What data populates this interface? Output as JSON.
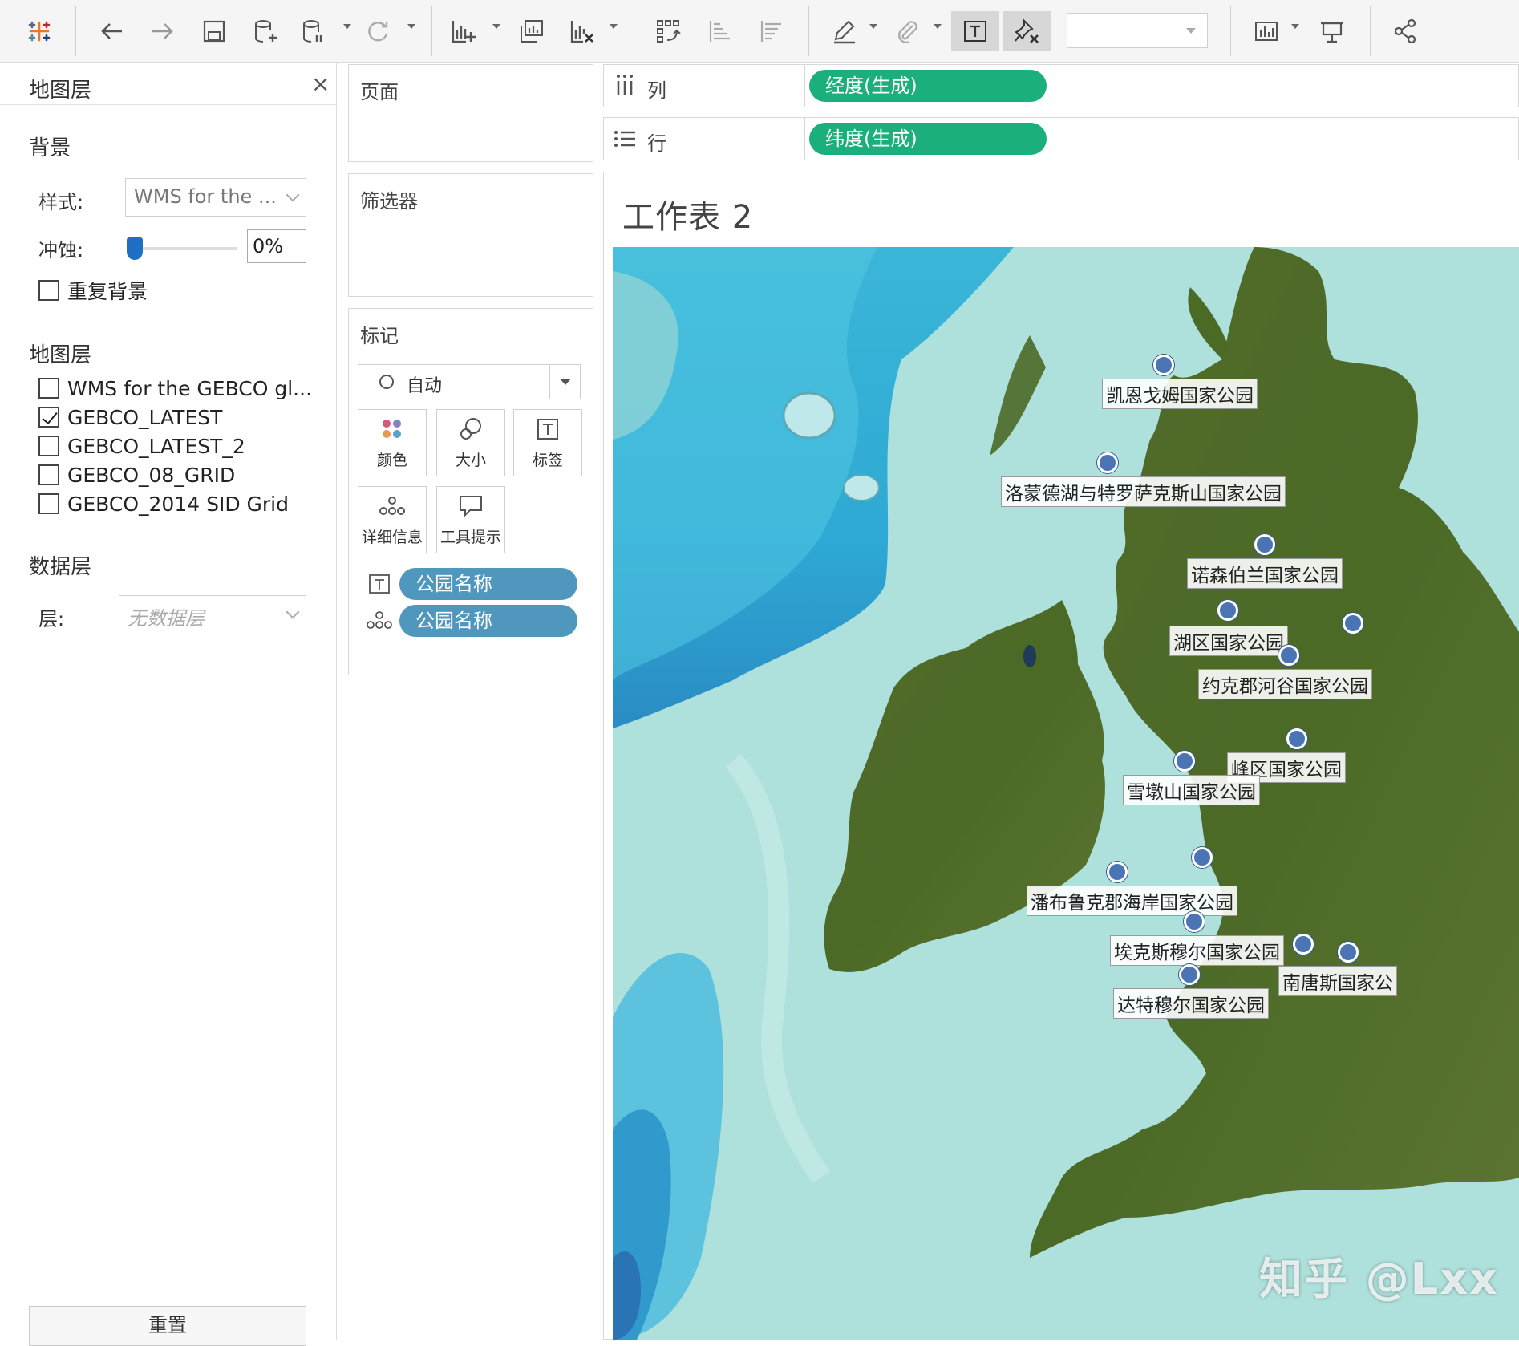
{
  "left_panel": {
    "title": "地图层",
    "background_section": "背景",
    "style_label": "样式:",
    "style_value": "WMS for the ...",
    "washout_label": "冲蚀:",
    "washout_value": "0%",
    "washout_fraction": 0,
    "repeat_background_label": "重复背景",
    "repeat_background_checked": false,
    "map_layers_section": "地图层",
    "layers": [
      {
        "label": "WMS for the GEBCO gl...",
        "checked": false
      },
      {
        "label": "GEBCO_LATEST",
        "checked": true
      },
      {
        "label": "GEBCO_LATEST_2",
        "checked": false
      },
      {
        "label": "GEBCO_08_GRID",
        "checked": false
      },
      {
        "label": "GEBCO_2014 SID Grid",
        "checked": false
      }
    ],
    "data_layer_section": "数据层",
    "layer_label": "层:",
    "layer_placeholder": "无数据层",
    "reset_label": "重置"
  },
  "cards": {
    "pages": "页面",
    "filters": "筛选器",
    "marks": "标记",
    "mark_type": "自动",
    "mark_buttons": {
      "color": "颜色",
      "size": "大小",
      "label": "标签",
      "detail": "详细信息",
      "tooltip": "工具提示"
    },
    "label_pill": "公园名称",
    "detail_pill": "公园名称"
  },
  "shelves": {
    "columns_label": "列",
    "columns_pill": "经度(生成)",
    "rows_label": "行",
    "rows_pill": "纬度(生成)"
  },
  "sheet": {
    "title": "工作表 2",
    "parks": [
      {
        "name": "凯恩戈姆国家公园"
      },
      {
        "name": "洛蒙德湖与特罗萨克斯山国家公园"
      },
      {
        "name": "诺森伯兰国家公园"
      },
      {
        "name": "湖区国家公园"
      },
      {
        "name": "约克郡河谷国家公园"
      },
      {
        "name": "峰区国家公园"
      },
      {
        "name": "雪墩山国家公园"
      },
      {
        "name": "潘布鲁克郡海岸国家公园"
      },
      {
        "name": "埃克斯穆尔国家公园"
      },
      {
        "name": "达特穆尔国家公园"
      },
      {
        "name": "南唐斯国家公"
      }
    ],
    "watermark": "知乎 @Lxx"
  },
  "colors": {
    "green_pill": "#1bb07b",
    "blue_pill": "#4f97bd",
    "mark_dot": "#4b74b5",
    "slider": "#1f6fc5"
  },
  "icons": [
    "tableau-logo-icon",
    "back-arrow-icon",
    "forward-arrow-icon",
    "save-icon",
    "new-datasource-icon",
    "datasource-pause-icon",
    "refresh-icon",
    "new-worksheet-icon",
    "duplicate-sheet-icon",
    "clear-sheet-icon",
    "swap-icon",
    "sort-ascending-icon",
    "sort-descending-icon",
    "highlight-pen-icon",
    "paperclip-icon",
    "show-labels-icon",
    "fix-axes-icon",
    "show-me-icon",
    "presentation-icon",
    "share-icon"
  ]
}
